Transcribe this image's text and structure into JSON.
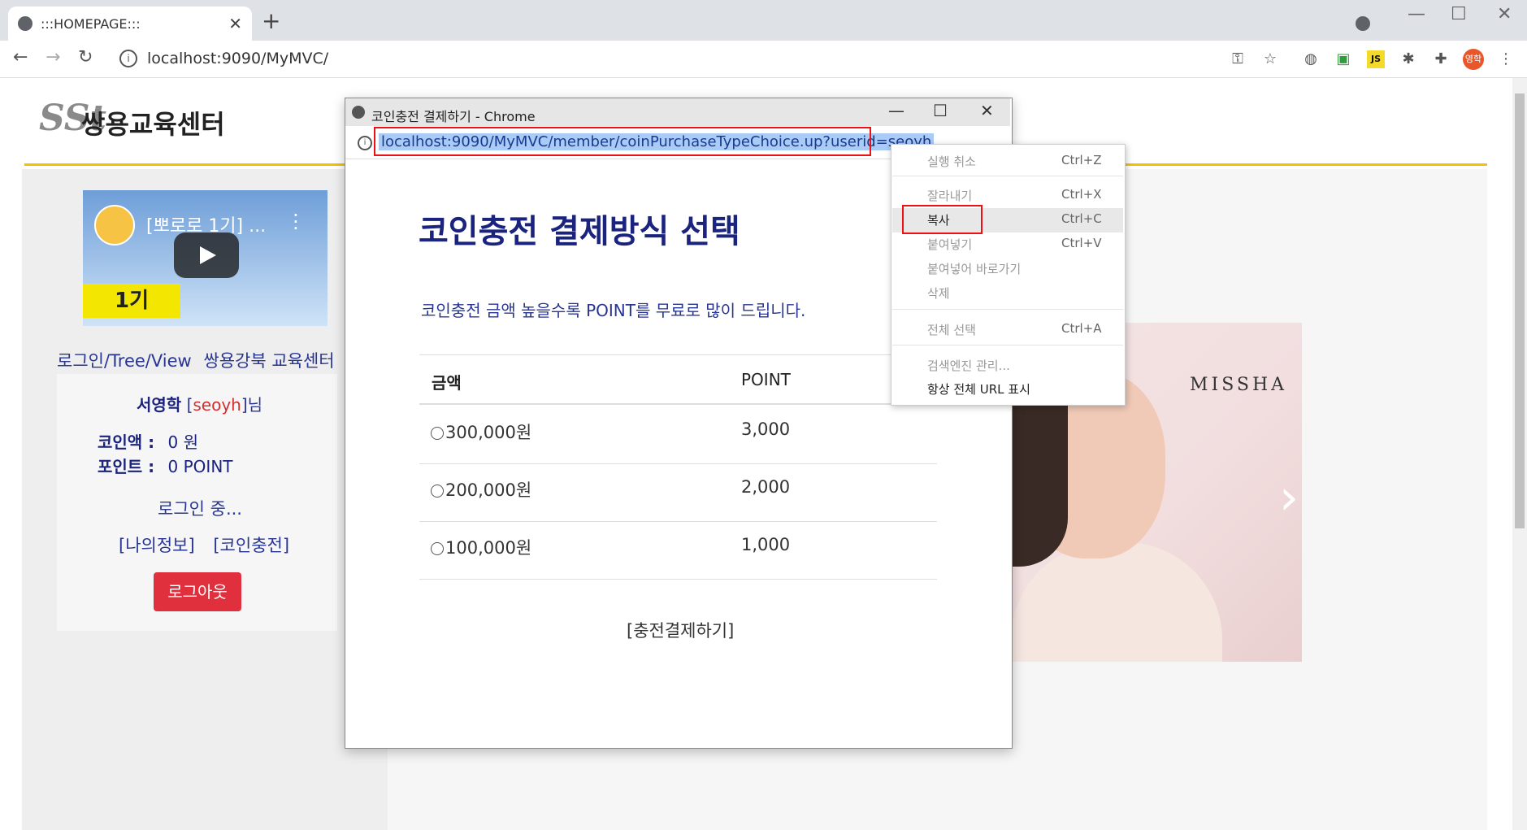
{
  "browser": {
    "tab_title": ":::HOMEPAGE:::",
    "address": "localhost:9090/MyMVC/",
    "profile_label": "영학"
  },
  "site": {
    "logo_mark": "SSt",
    "logo_text": "쌍용교육센터",
    "video_title": "[뽀로로 1기] ...",
    "video_badge": "1기",
    "nav_links": [
      "로그인/Tree/View",
      "쌍용강북 교육센터"
    ],
    "user": {
      "name": "서영학",
      "id": "seoyh",
      "suffix": "님",
      "coin_label": "코인액 :",
      "coin_value": "0 원",
      "point_label": "포인트 :",
      "point_value": "0 POINT",
      "status": "로그인 중...",
      "link_myinfo": "[나의정보]",
      "link_coin": "[코인충전]",
      "logout_label": "로그아웃"
    },
    "ad_brand": "MISSHA"
  },
  "popup": {
    "window_title": "코인충전 결제하기 - Chrome",
    "url": "localhost:9090/MyMVC/member/coinPurchaseTypeChoice.up?userid=seoyh",
    "heading": "코인충전 결제방식 선택",
    "subtitle": "코인충전 금액 높을수록 POINT를 무료로 많이 드립니다.",
    "table": {
      "headers": [
        "금액",
        "POINT"
      ],
      "rows": [
        {
          "amount": "300,000원",
          "point": "3,000"
        },
        {
          "amount": "200,000원",
          "point": "2,000"
        },
        {
          "amount": "100,000원",
          "point": "1,000"
        }
      ]
    },
    "submit_label": "[충전결제하기]"
  },
  "context_menu": {
    "items": [
      {
        "label": "실행 취소",
        "shortcut": "Ctrl+Z",
        "enabled": false
      },
      {
        "label": "잘라내기",
        "shortcut": "Ctrl+X",
        "enabled": false
      },
      {
        "label": "복사",
        "shortcut": "Ctrl+C",
        "enabled": true
      },
      {
        "label": "붙여넣기",
        "shortcut": "Ctrl+V",
        "enabled": false
      },
      {
        "label": "붙여넣어 바로가기",
        "shortcut": "",
        "enabled": false
      },
      {
        "label": "삭제",
        "shortcut": "",
        "enabled": false
      },
      {
        "label": "전체 선택",
        "shortcut": "Ctrl+A",
        "enabled": false
      },
      {
        "label": "검색엔진 관리...",
        "shortcut": "",
        "enabled": false
      },
      {
        "label": "항상 전체 URL 표시",
        "shortcut": "",
        "enabled": true
      }
    ]
  },
  "colors": {
    "accent_navy": "#1a237e",
    "logout_red": "#e0303d",
    "highlight_box": "#ee1111",
    "gold_line": "#f3c100"
  }
}
